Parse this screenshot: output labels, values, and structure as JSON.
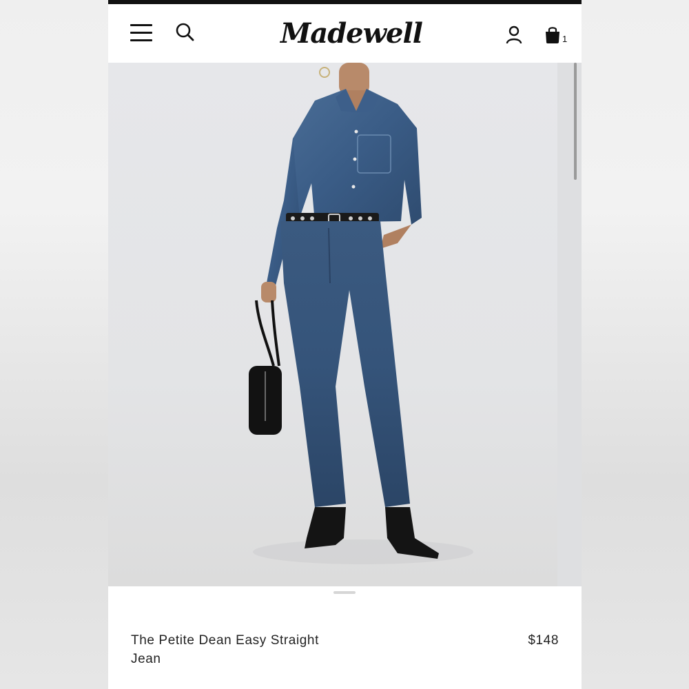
{
  "header": {
    "logo_text": "Madewell",
    "icons": {
      "menu": "hamburger-menu-icon",
      "search": "search-icon",
      "account": "account-icon",
      "bag": "shopping-bag-icon"
    },
    "bag_count": "1"
  },
  "product": {
    "image": "model-wearing-denim-shirt-and-straight-jeans",
    "title": "The Petite Dean Easy Straight Jean",
    "price": "$148"
  },
  "colors": {
    "text": "#111111",
    "background": "#ffffff",
    "denim": "#35547a"
  }
}
